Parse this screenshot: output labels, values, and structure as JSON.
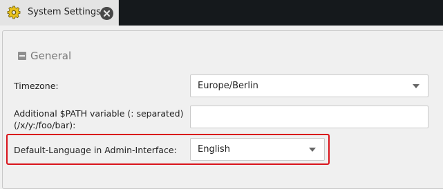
{
  "tab": {
    "title": "System Settings",
    "icon": "gear-icon",
    "close_icon": "close-icon"
  },
  "section": {
    "legend": "General",
    "collapse_icon": "minus-square-icon"
  },
  "fields": {
    "timezone": {
      "label": "Timezone:",
      "value": "Europe/Berlin"
    },
    "path": {
      "label_line1": "Additional $PATH variable (: separated)",
      "label_line2": "(/x/y:/foo/bar):",
      "value": ""
    },
    "language": {
      "label": "Default-Language in Admin-Interface:",
      "value": "English"
    }
  },
  "colors": {
    "tabbar_bg": "#15191c",
    "tab_bg": "#e4e4e4",
    "gear": "#e9c21b",
    "highlight": "#d9131b"
  }
}
